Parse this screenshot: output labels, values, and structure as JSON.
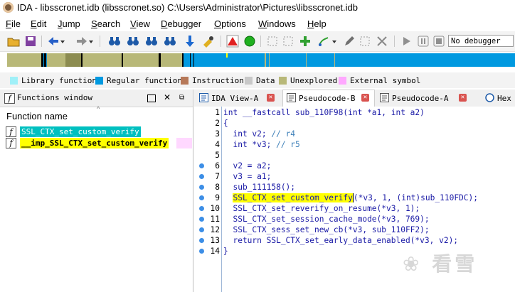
{
  "window": {
    "title": "IDA - libsscronet.idb (libsscronet.so) C:\\Users\\Administrator\\Pictures\\libsscronet.idb"
  },
  "menu": [
    "File",
    "Edit",
    "Jump",
    "Search",
    "View",
    "Debugger",
    "Options",
    "Windows",
    "Help"
  ],
  "toolbar": {
    "debugger_select": "No debugger"
  },
  "legend": [
    {
      "label": "Library function",
      "color": "#a0f0f8"
    },
    {
      "label": "Regular function",
      "color": "#0099e0"
    },
    {
      "label": "Instruction",
      "color": "#b67858"
    },
    {
      "label": "Data",
      "color": "#c8c8c8"
    },
    {
      "label": "Unexplored",
      "color": "#b8b878"
    },
    {
      "label": "External symbol",
      "color": "#ffa8ff"
    }
  ],
  "functions_window": {
    "title": "Functions window",
    "column": "Function name",
    "items": [
      {
        "name": "SSL_CTX_set_custom_verify",
        "bg": "#00c0c0",
        "color": "#ffffff"
      },
      {
        "name": "__imp_SSL_CTX_set_custom_verify",
        "bg": "#ffff00",
        "color": "#000000",
        "bold": true,
        "rowbg": "#ffd8ff"
      }
    ]
  },
  "tabs": [
    {
      "label": "IDA View-A"
    },
    {
      "label": "Pseudocode-B"
    },
    {
      "label": "Pseudocode-A"
    },
    {
      "label": "Hex"
    }
  ],
  "code": {
    "lines": [
      {
        "n": "1",
        "dot": false,
        "text": "int __fastcall sub_110F98(int *a1, int a2)"
      },
      {
        "n": "2",
        "dot": false,
        "text": "{"
      },
      {
        "n": "3",
        "dot": false,
        "pre": "  int v2; ",
        "comment": "// r4"
      },
      {
        "n": "4",
        "dot": false,
        "pre": "  int *v3; ",
        "comment": "// r5"
      },
      {
        "n": "5",
        "dot": false,
        "text": ""
      },
      {
        "n": "6",
        "dot": true,
        "text": "  v2 = a2;"
      },
      {
        "n": "7",
        "dot": true,
        "text": "  v3 = a1;"
      },
      {
        "n": "8",
        "dot": true,
        "text": "  sub_111158();"
      },
      {
        "n": "9",
        "dot": true,
        "pre": "  ",
        "highlight": "SSL_CTX_set_custom_verify",
        "post": "(*v3, 1, (int)sub_110FDC);"
      },
      {
        "n": "10",
        "dot": true,
        "text": "  SSL_CTX_set_reverify_on_resume(*v3, 1);"
      },
      {
        "n": "11",
        "dot": true,
        "text": "  SSL_CTX_set_session_cache_mode(*v3, 769);"
      },
      {
        "n": "12",
        "dot": true,
        "text": "  SSL_CTX_sess_set_new_cb(*v3, sub_110FF2);"
      },
      {
        "n": "13",
        "dot": true,
        "text": "  return SSL_CTX_set_early_data_enabled(*v3, v2);"
      },
      {
        "n": "14",
        "dot": true,
        "text": "}"
      }
    ]
  },
  "watermark": "看雪"
}
